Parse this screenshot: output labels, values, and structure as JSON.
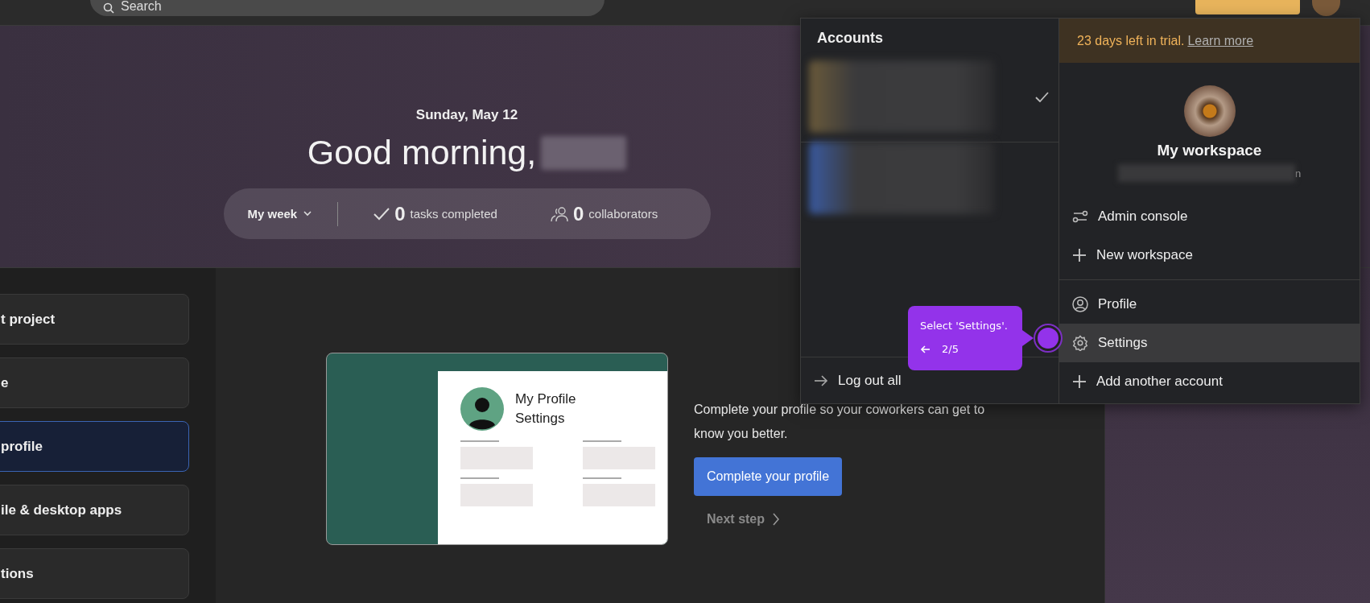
{
  "top_bar": {
    "search": {
      "placeholder": "Search"
    }
  },
  "hero": {
    "date": "Sunday, May 12",
    "greeting": "Good morning,",
    "stats": {
      "period": "My week",
      "tasks_count": "0",
      "tasks_label": "tasks completed",
      "collaborators_count": "0",
      "collaborators_label": "collaborators"
    }
  },
  "steps": [
    {
      "label": "t project",
      "selected": false
    },
    {
      "label": "e",
      "selected": false
    },
    {
      "label": "profile",
      "selected": true
    },
    {
      "label": "ile & desktop apps",
      "selected": false
    },
    {
      "label": "tions",
      "selected": false
    }
  ],
  "profile_step": {
    "card_title": "My Profile Settings",
    "description": "Complete your profile so your coworkers can get to know you better.",
    "button": "Complete your profile",
    "next": "Next step"
  },
  "account_menu": {
    "title": "Accounts",
    "accounts": [
      {
        "selected": true
      },
      {
        "selected": false
      }
    ],
    "logout": "Log out all",
    "trial": {
      "text": "23 days left in trial.",
      "link": "Learn more"
    },
    "workspace": {
      "name": "My workspace",
      "email_visible": "n"
    },
    "groups": [
      [
        {
          "kind": "sliders",
          "label": "Admin console",
          "selected": false
        },
        {
          "kind": "plus",
          "label": "New workspace",
          "selected": false
        }
      ],
      [
        {
          "kind": "person",
          "label": "Profile",
          "selected": false
        },
        {
          "kind": "gear",
          "label": "Settings",
          "selected": true
        },
        {
          "kind": "plus",
          "label": "Add another account",
          "selected": false
        }
      ]
    ]
  },
  "guide": {
    "text": "Select 'Settings'.",
    "step": "2/5"
  }
}
